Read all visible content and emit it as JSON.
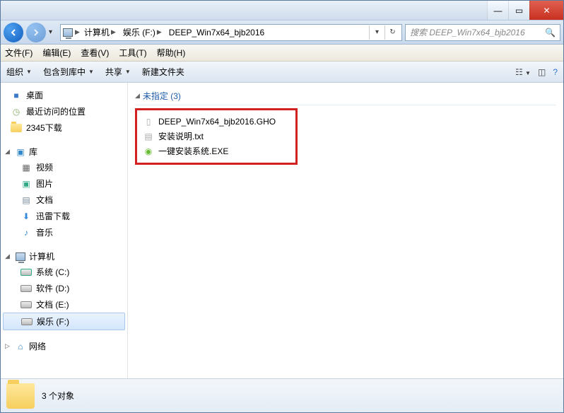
{
  "titlebar": {
    "min": "—",
    "max": "▭",
    "close": "✕"
  },
  "nav": {
    "crumbs": [
      {
        "label": "计算机"
      },
      {
        "label": "娱乐 (F:)"
      },
      {
        "label": "DEEP_Win7x64_bjb2016"
      }
    ],
    "search_placeholder": "搜索 DEEP_Win7x64_bjb2016"
  },
  "menubar": [
    "文件(F)",
    "编辑(E)",
    "查看(V)",
    "工具(T)",
    "帮助(H)"
  ],
  "toolbar": {
    "organize": "组织",
    "include": "包含到库中",
    "share": "共享",
    "newfolder": "新建文件夹"
  },
  "sidebar": {
    "favorites": [
      {
        "name": "桌面",
        "icon": "desktop"
      },
      {
        "name": "最近访问的位置",
        "icon": "recent"
      },
      {
        "name": "2345下载",
        "icon": "folder"
      }
    ],
    "libraries_hdr": "库",
    "libraries": [
      {
        "name": "视频",
        "icon": "video"
      },
      {
        "name": "图片",
        "icon": "picture"
      },
      {
        "name": "文档",
        "icon": "doc"
      },
      {
        "name": "迅雷下载",
        "icon": "download"
      },
      {
        "name": "音乐",
        "icon": "music"
      }
    ],
    "computer_hdr": "计算机",
    "computer": [
      {
        "name": "系统 (C:)",
        "icon": "sysdrive"
      },
      {
        "name": "软件 (D:)",
        "icon": "drive"
      },
      {
        "name": "文档 (E:)",
        "icon": "drive"
      },
      {
        "name": "娱乐 (F:)",
        "icon": "drive",
        "selected": true
      }
    ],
    "network_hdr": "网络"
  },
  "main": {
    "group_header": "未指定 (3)",
    "files": [
      {
        "name": "DEEP_Win7x64_bjb2016.GHO",
        "icon": "file"
      },
      {
        "name": "安装说明.txt",
        "icon": "txt"
      },
      {
        "name": "一键安装系统.EXE",
        "icon": "exe"
      }
    ]
  },
  "status": {
    "text": "3 个对象"
  }
}
